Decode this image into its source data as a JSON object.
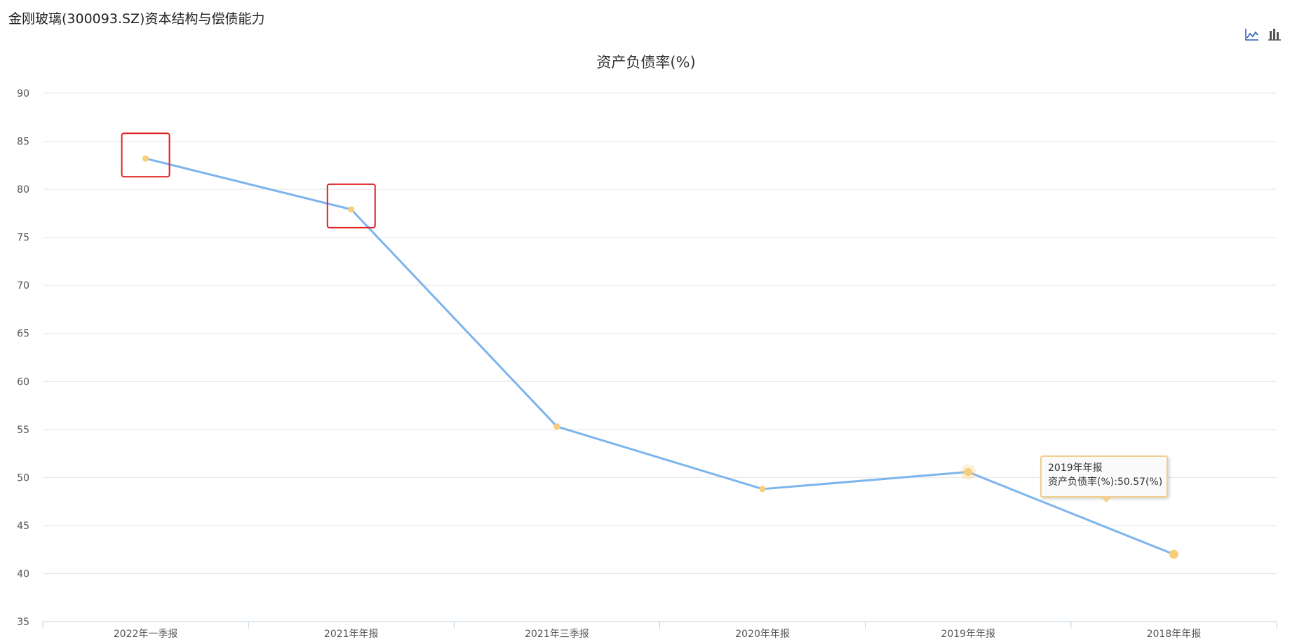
{
  "page": {
    "title": "金刚玻璃(300093.SZ)资本结构与偿债能力"
  },
  "toolbar": {
    "line_icon": "line-chart-icon",
    "bar_icon": "bar-chart-icon"
  },
  "colors": {
    "line": "#7cb5ec",
    "point": "#f7cd7a",
    "grid": "#e6e6e6",
    "axis": "#c0d0e0",
    "highlight_box": "#e02020"
  },
  "chart_data": {
    "type": "line",
    "title": "资产负债率(%)",
    "categories": [
      "2022年一季报",
      "2021年年报",
      "2021年三季报",
      "2020年年报",
      "2019年年报",
      "2018年年报"
    ],
    "series": [
      {
        "values": [
          83.2,
          77.9,
          55.3,
          48.8,
          50.57,
          42.0
        ]
      }
    ],
    "yticks": [
      35,
      40,
      45,
      50,
      55,
      60,
      65,
      70,
      75,
      80,
      85,
      90
    ],
    "ylim": [
      35,
      90
    ],
    "grid": true,
    "highlighted_categories": [
      "2022年一季报",
      "2021年年报"
    ],
    "tooltip": {
      "category": "2019年年报",
      "text": "资产负债率(%):50.57(%)"
    }
  }
}
